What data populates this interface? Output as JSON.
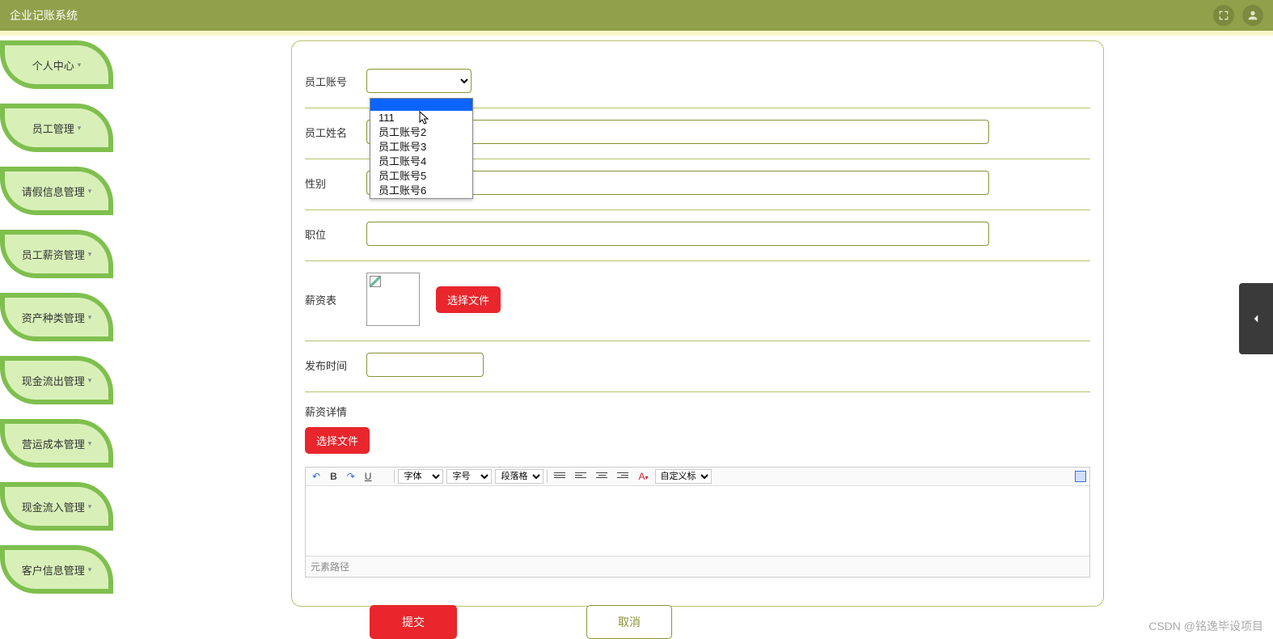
{
  "header": {
    "title": "企业记账系统"
  },
  "sidebar": {
    "items": [
      {
        "label": "个人中心"
      },
      {
        "label": "员工管理"
      },
      {
        "label": "请假信息管理"
      },
      {
        "label": "员工薪资管理"
      },
      {
        "label": "资产种类管理"
      },
      {
        "label": "现金流出管理"
      },
      {
        "label": "营运成本管理"
      },
      {
        "label": "现金流入管理"
      },
      {
        "label": "客户信息管理"
      }
    ]
  },
  "form": {
    "account_label": "员工账号",
    "account_options": [
      "",
      "111",
      "员工账号2",
      "员工账号3",
      "员工账号4",
      "员工账号5",
      "员工账号6"
    ],
    "name_label": "员工姓名",
    "gender_label": "性别",
    "position_label": "职位",
    "salary_table_label": "薪资表",
    "choose_file": "选择文件",
    "publish_time_label": "发布时间",
    "salary_detail_label": "薪资详情",
    "submit": "提交",
    "cancel": "取消"
  },
  "editor": {
    "font_placeholder": "字体",
    "size_placeholder": "字号",
    "para_placeholder": "段落格式",
    "custom_title": "自定义标题",
    "status": "元素路径"
  },
  "watermark": "CSDN @铭逸毕设项目"
}
